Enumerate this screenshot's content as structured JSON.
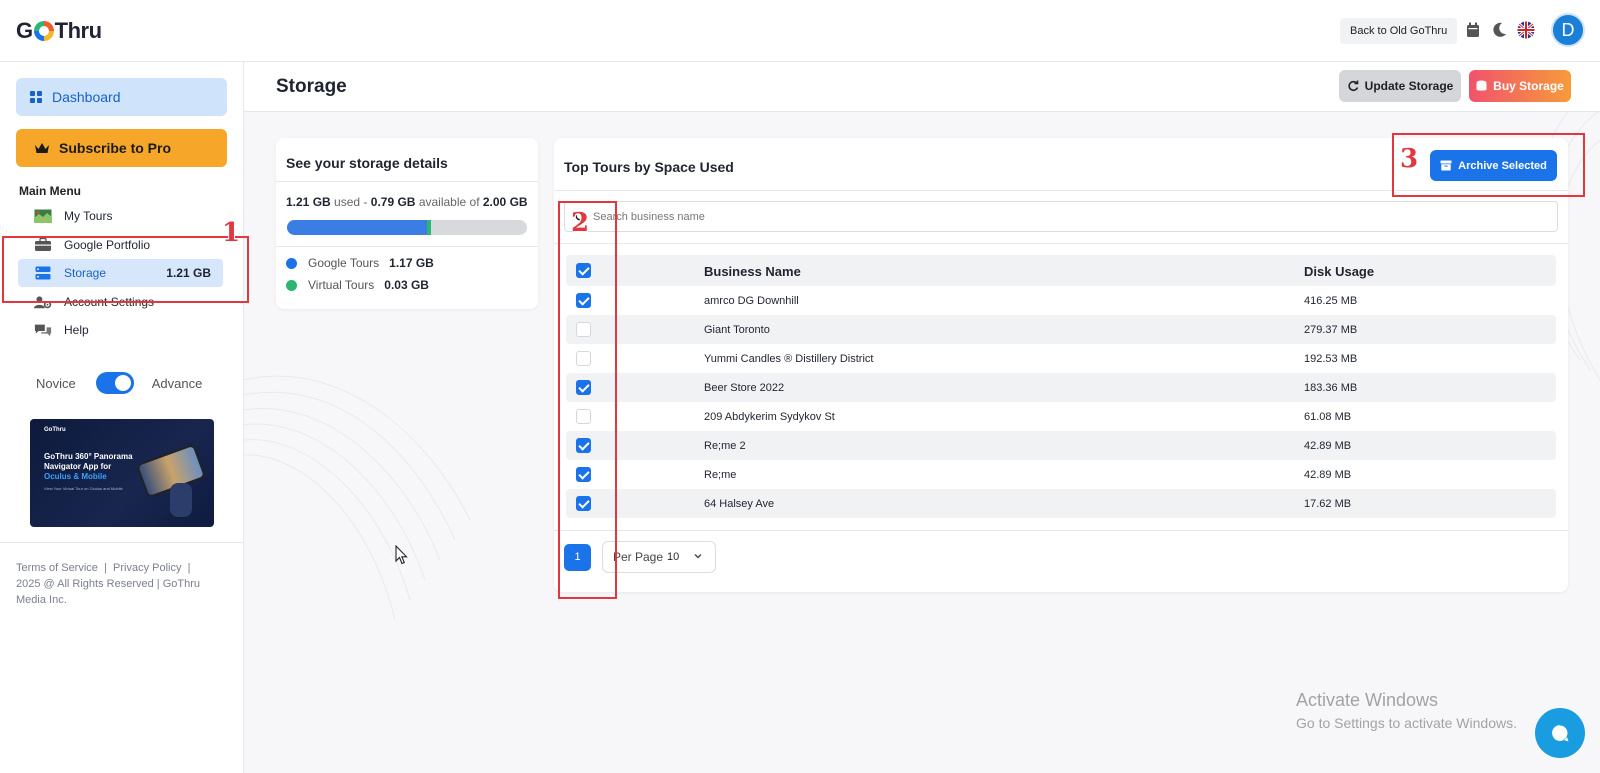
{
  "header": {
    "logo_text": "GoThru",
    "back_label": "Back to Old GoThru",
    "avatar_initial": "D"
  },
  "sidebar": {
    "dashboard_label": "Dashboard",
    "subscribe_label": "Subscribe to Pro",
    "main_menu_title": "Main Menu",
    "items": [
      {
        "label": "My Tours",
        "icon": "map-icon"
      },
      {
        "label": "Google Portfolio",
        "icon": "briefcase-icon"
      },
      {
        "label": "Storage",
        "icon": "server-icon",
        "size": "1.21 GB",
        "active": true
      },
      {
        "label": "Account Settings",
        "icon": "user-gear-icon"
      },
      {
        "label": "Help",
        "icon": "chat-icon"
      }
    ],
    "toggle": {
      "left": "Novice",
      "right": "Advance",
      "state": "Advance"
    },
    "promo": {
      "logo": "GoThru",
      "title_line": "GoThru 360° Panorama Navigator App for",
      "title_highlight": "Oculus & Mobile",
      "subtitle": "View Your Virtual Tour on Oculus and Mobile"
    },
    "footer": {
      "terms": "Terms of Service",
      "privacy": "Privacy Policy",
      "copyright": "2025 @ All Rights Reserved | GoThru Media Inc."
    }
  },
  "page": {
    "title": "Storage",
    "update_label": "Update Storage",
    "buy_label": "Buy Storage"
  },
  "storage_card": {
    "title": "See your storage details",
    "used": "1.21 GB",
    "used_word": "used",
    "separator": "-",
    "available": "0.79 GB",
    "available_word": "available of",
    "total": "2.00 GB",
    "google_fraction": 0.585,
    "virtual_fraction": 0.015,
    "legend": [
      {
        "label": "Google Tours",
        "value": "1.17 GB",
        "color": "#1a73e8"
      },
      {
        "label": "Virtual Tours",
        "value": "0.03 GB",
        "color": "#2bb673"
      }
    ]
  },
  "tours_card": {
    "title": "Top Tours by Space Used",
    "archive_label": "Archive Selected",
    "search_placeholder": "Search business name",
    "columns": {
      "name": "Business Name",
      "disk": "Disk Usage"
    },
    "header_checked": true,
    "rows": [
      {
        "name": "amrco DG Downhill",
        "disk": "416.25 MB",
        "checked": true
      },
      {
        "name": "Giant Toronto",
        "disk": "279.37 MB",
        "checked": false
      },
      {
        "name": "Yummi Candles ® Distillery District",
        "disk": "192.53 MB",
        "checked": false
      },
      {
        "name": "Beer Store 2022",
        "disk": "183.36 MB",
        "checked": true
      },
      {
        "name": "209 Abdykerim Sydykov St",
        "disk": "61.08 MB",
        "checked": false
      },
      {
        "name": "Re;me 2",
        "disk": "42.89 MB",
        "checked": true
      },
      {
        "name": "Re;me",
        "disk": "42.89 MB",
        "checked": true
      },
      {
        "name": "64 Halsey Ave",
        "disk": "17.62 MB",
        "checked": true
      }
    ],
    "page_number": "1",
    "per_page_label": "Per Page",
    "per_page_value": "10"
  },
  "annotations": [
    "1",
    "2",
    "3"
  ],
  "watermark": {
    "line1": "Activate Windows",
    "line2": "Go to Settings to activate Windows."
  }
}
